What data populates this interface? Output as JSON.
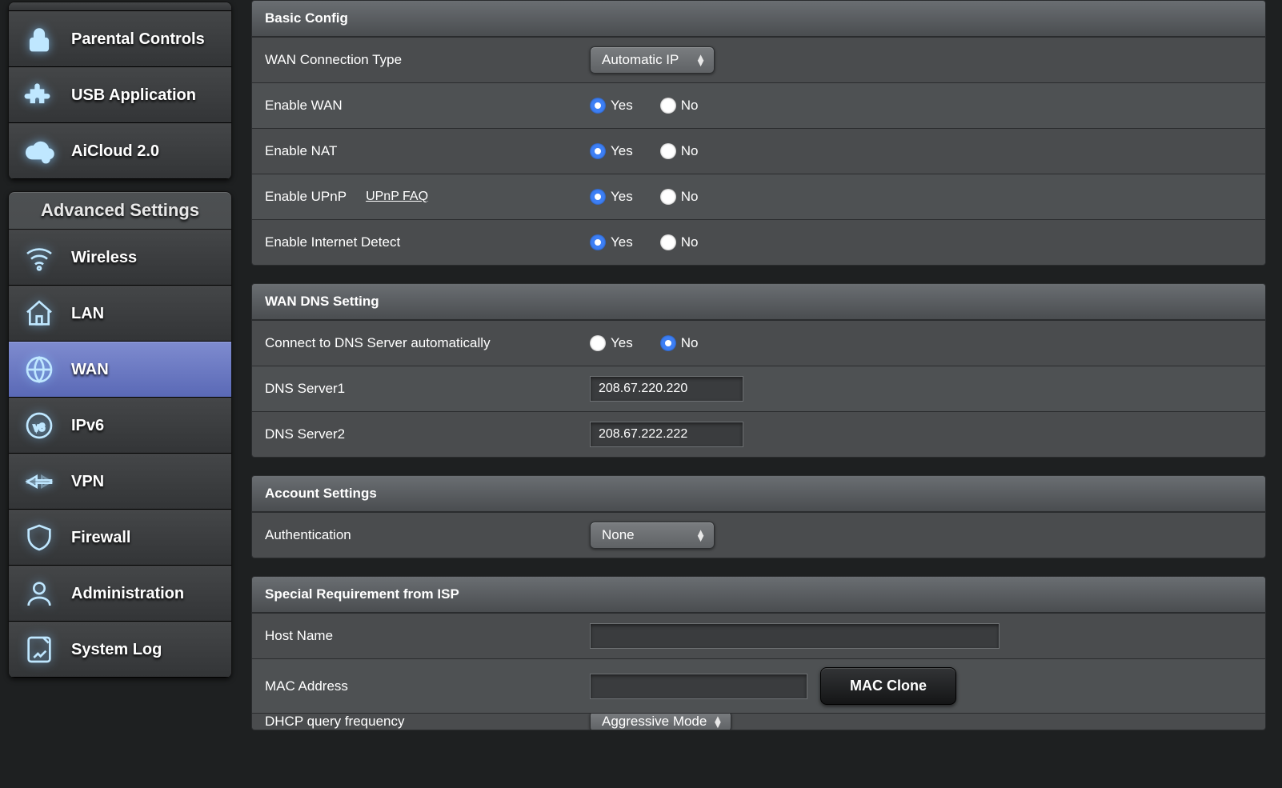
{
  "sidebar": {
    "general_items": [
      {
        "id": "traffic",
        "label": ""
      },
      {
        "id": "parental",
        "label": "Parental Controls"
      },
      {
        "id": "usb",
        "label": "USB Application"
      },
      {
        "id": "aicloud",
        "label": "AiCloud 2.0"
      }
    ],
    "advanced_header": "Advanced Settings",
    "advanced_items": [
      {
        "id": "wireless",
        "label": "Wireless"
      },
      {
        "id": "lan",
        "label": "LAN"
      },
      {
        "id": "wan",
        "label": "WAN",
        "active": true
      },
      {
        "id": "ipv6",
        "label": "IPv6"
      },
      {
        "id": "vpn",
        "label": "VPN"
      },
      {
        "id": "firewall",
        "label": "Firewall"
      },
      {
        "id": "admin",
        "label": "Administration"
      },
      {
        "id": "syslog",
        "label": "System Log"
      }
    ]
  },
  "labels": {
    "yes": "Yes",
    "no": "No"
  },
  "basic": {
    "header": "Basic Config",
    "wan_type_label": "WAN Connection Type",
    "wan_type_value": "Automatic IP",
    "enable_wan_label": "Enable WAN",
    "enable_wan": "yes",
    "enable_nat_label": "Enable NAT",
    "enable_nat": "yes",
    "enable_upnp_label": "Enable UPnP",
    "upnp_faq": "UPnP FAQ",
    "enable_upnp": "yes",
    "enable_idetect_label": "Enable Internet Detect",
    "enable_idetect": "yes"
  },
  "dns": {
    "header": "WAN DNS Setting",
    "auto_label": "Connect to DNS Server automatically",
    "auto": "no",
    "s1_label": "DNS Server1",
    "s1_value": "208.67.220.220",
    "s2_label": "DNS Server2",
    "s2_value": "208.67.222.222"
  },
  "account": {
    "header": "Account Settings",
    "auth_label": "Authentication",
    "auth_value": "None"
  },
  "isp": {
    "header": "Special Requirement from ISP",
    "host_label": "Host Name",
    "host_value": "",
    "mac_label": "MAC Address",
    "mac_value": "",
    "mac_clone_btn": "MAC Clone",
    "dhcp_label": "DHCP query frequency",
    "dhcp_value": "Aggressive Mode"
  }
}
